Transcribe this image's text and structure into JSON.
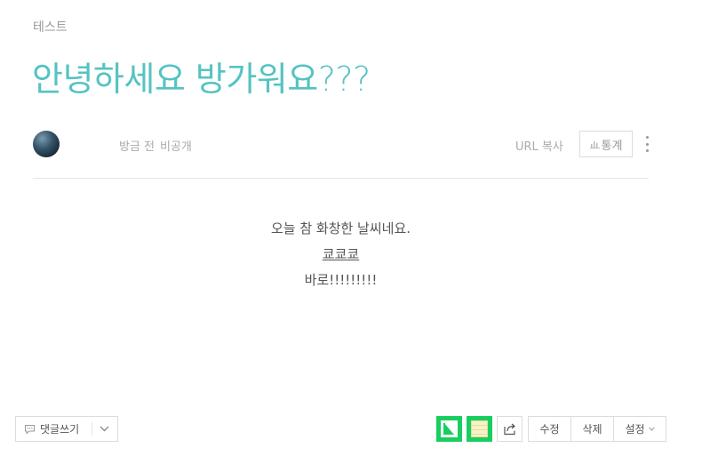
{
  "post": {
    "category": "테스트",
    "title": "안녕하세요 방가워요???",
    "meta": {
      "time": "방금 전",
      "visibility": "비공개",
      "url_copy_label": "URL 복사",
      "stats_label": "통계"
    },
    "content": {
      "line1": "오늘 참 화창한 날씨네요.",
      "link_text": "쿄쿄쿄",
      "line3": "바로!!!!!!!!!"
    }
  },
  "footer": {
    "comment_label": "댓글쓰기",
    "edit_label": "수정",
    "delete_label": "삭제",
    "settings_label": "설정"
  },
  "colors": {
    "title": "#55c3c2",
    "green_button": "#19ce60",
    "muted_text": "#aaaaaa"
  },
  "icons": [
    "avatar",
    "bar-chart-icon",
    "more-vertical-icon",
    "comment-bubble-icon",
    "chevron-down-icon",
    "keep-bookmark-icon",
    "memo-icon",
    "share-icon"
  ]
}
